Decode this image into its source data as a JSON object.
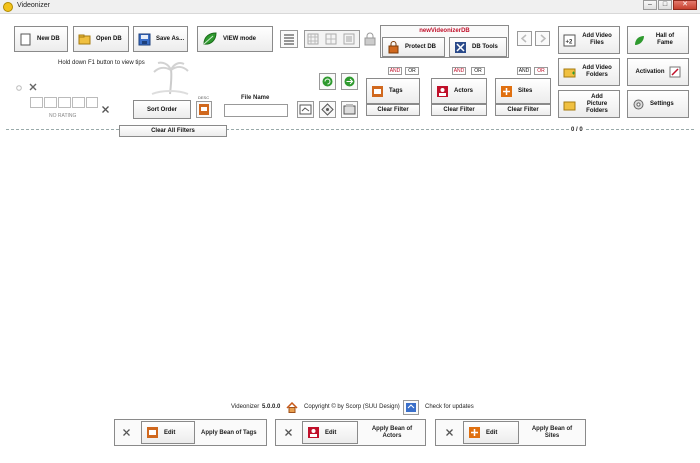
{
  "window": {
    "title": "Videonizer",
    "minimize_symbol": "–",
    "maximize_symbol": "□",
    "close_symbol": "✕"
  },
  "toolbar": {
    "new_db": "New DB",
    "open_db": "Open DB",
    "save_as": "Save As...",
    "view_mode": "VIEW mode",
    "db_name": "newVideonizerDB",
    "protect_db": "Protect DB",
    "db_tools": "DB Tools",
    "add_video_files": [
      "Add Video",
      "Files"
    ],
    "hall_of_fame": [
      "Hall of",
      "Fame"
    ],
    "add_video_folders": [
      "Add Video",
      "Folders"
    ],
    "activation": "Activation",
    "add_picture_folders": [
      "Add",
      "Picture",
      "Folders"
    ],
    "settings": "Settings"
  },
  "filters": {
    "tip_text": "Hold down F1 button to view tips",
    "no_rating": "NO RATING",
    "sort_order": "Sort Order",
    "desc": "DESC",
    "file_name_label": "File Name",
    "file_name_value": "",
    "and_label": "AND",
    "or_label": "OR",
    "tags": "Tags",
    "actors": "Actors",
    "sites": "Sites",
    "clear_filter": "Clear Filter",
    "clear_all_filters": "Clear All Filters",
    "count": "0 / 0"
  },
  "status": {
    "app_name": "Videonizer",
    "version": "5.0.0.0",
    "copyright": "Copyright © by Scorp (SUU Design)",
    "check_updates": "Check for updates"
  },
  "bottom": {
    "edit": "Edit",
    "apply_tags": "Apply Bean of Tags",
    "apply_actors": [
      "Apply Bean of",
      "Actors"
    ],
    "apply_sites": [
      "Apply Bean of",
      "Sites"
    ]
  },
  "colors": {
    "accent_red": "#c0102a",
    "green_icon": "#2f9a2f",
    "folder_yellow": "#f0c040"
  }
}
